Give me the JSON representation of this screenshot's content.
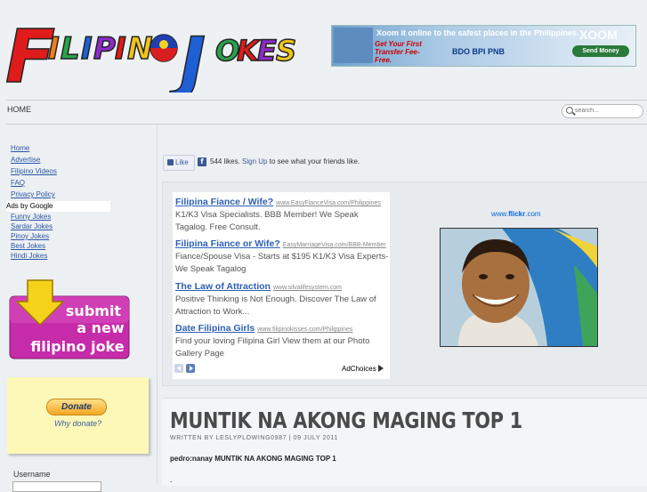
{
  "header": {
    "logo_text": "FILIPINO JOKES",
    "banner": {
      "headline": "Xoom it online to the safest places in the Philippines.",
      "promo": "Get Your First Transfer Fee-Free.",
      "brand": "XOOM",
      "button": "Send Money",
      "banks": "BDO  BPI  PNB"
    }
  },
  "nav": {
    "home": "HOME",
    "search_placeholder": "search..."
  },
  "sidebar": {
    "links": [
      "Home",
      "Advertise",
      "Filipino Videos",
      "FAQ",
      "Privacy Policy"
    ],
    "ads_label": "Ads by Google",
    "ad_links": [
      "Funny Jokes",
      "Sardar Jokes",
      "Pinoy Jokes",
      "Best Jokes",
      "Hindi Jokes"
    ],
    "submit": {
      "line1": "submit",
      "line2": "a new",
      "line3": "filipino joke"
    },
    "donate": {
      "button": "Donate",
      "why": "Why donate?"
    },
    "username_label": "Username"
  },
  "facebook": {
    "like_button": "Like",
    "count_text": "544 likes.",
    "signup": "Sign Up",
    "suffix": "to see what your friends like."
  },
  "ads": [
    {
      "title": "Filipina Fiance / Wife?",
      "url": "www.EasyFianceVisa.com/Philippines",
      "desc": "K1/K3 Visa Specialists. BBB Member! We Speak Tagalog. Free Consult."
    },
    {
      "title": "Filipina Fiance or Wife?",
      "url": "EasyMarriageVisa.com/BBB-Member",
      "desc": "Fiance/Spouse Visa - Starts at $195 K1/K3 Visa Experts-We Speak Tagalog"
    },
    {
      "title": "The Law of Attraction",
      "url": "www.silvalifesystem.com",
      "desc": "Positive Thinking is Not Enough. Discover The Law of Attraction to Work..."
    },
    {
      "title": "Date Filipina Girls",
      "url": "www.filipinokisses.com/Philippines",
      "desc": "Find your loving Filipina Girl View them at our Photo Gallery Page"
    }
  ],
  "adchoices": "AdChoices",
  "flickr": {
    "prefix": "www.",
    "brand": "flickr",
    "suffix": ".com"
  },
  "article": {
    "title": "MUNTIK NA AKONG MAGING TOP 1",
    "meta": "WRITTEN BY LESLYPLOWING0987 | 09 JULY 2011",
    "body": "pedro:nanay MUNTIK NA AKONG MAGING TOP 1",
    "trailing": "."
  },
  "colors": {
    "link": "#2a57a8",
    "ad_title": "#2d5fb4",
    "facebook": "#3b5998",
    "donate_bg": "#fdf8b8"
  }
}
